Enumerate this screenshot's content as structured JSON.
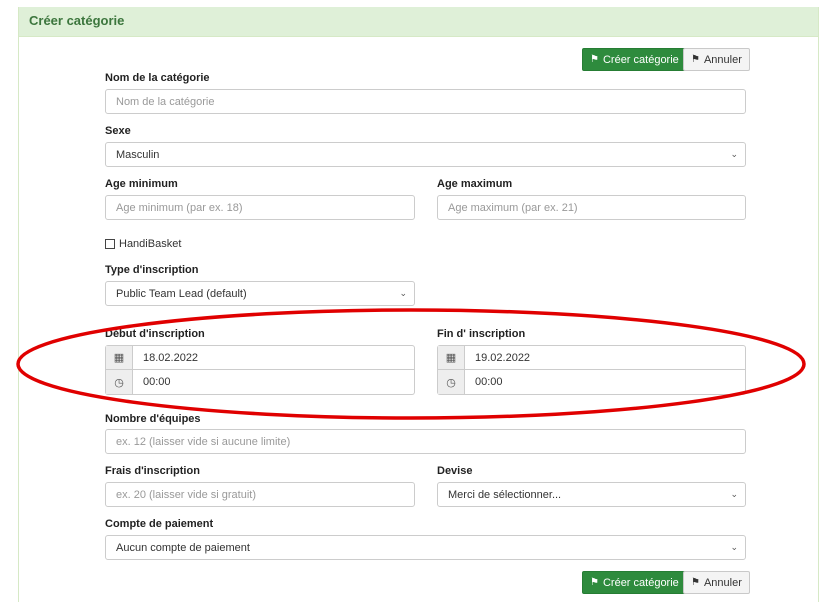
{
  "panel": {
    "title": "Créer catégorie"
  },
  "actions": {
    "create_label": "Créer catégorie",
    "cancel_label": "Annuler"
  },
  "form": {
    "name": {
      "label": "Nom de la catégorie",
      "placeholder": "Nom de la catégorie"
    },
    "sex": {
      "label": "Sexe",
      "value": "Masculin"
    },
    "age_min": {
      "label": "Age minimum",
      "placeholder": "Age minimum (par ex. 18)"
    },
    "age_max": {
      "label": "Age maximum",
      "placeholder": "Age maximum (par ex. 21)"
    },
    "handibasket": {
      "label": "HandiBasket",
      "checked": false
    },
    "registration_type": {
      "label": "Type d'inscription",
      "value": "Public Team Lead (default)"
    },
    "start": {
      "label": "Début d'inscription",
      "date": "18.02.2022",
      "time": "00:00"
    },
    "end": {
      "label": "Fin d' inscription",
      "date": "19.02.2022",
      "time": "00:00"
    },
    "teams": {
      "label": "Nombre d'équipes",
      "placeholder": "ex. 12 (laisser vide si aucune limite)"
    },
    "fee": {
      "label": "Frais d'inscription",
      "placeholder": "ex. 20 (laisser vide si gratuit)"
    },
    "currency": {
      "label": "Devise",
      "value": "Merci de sélectionner..."
    },
    "payment_account": {
      "label": "Compte de paiement",
      "value": "Aucun compte de paiement"
    }
  },
  "colors": {
    "success": "#2e8b3d",
    "heading_bg": "#dff0d8",
    "heading_text": "#3c763d",
    "annotation": "#e00000"
  },
  "icons": {
    "save": "save-icon",
    "cancel": "cancel-icon",
    "calendar": "calendar-icon",
    "clock": "clock-icon",
    "chevron": "chevron-down-icon"
  }
}
